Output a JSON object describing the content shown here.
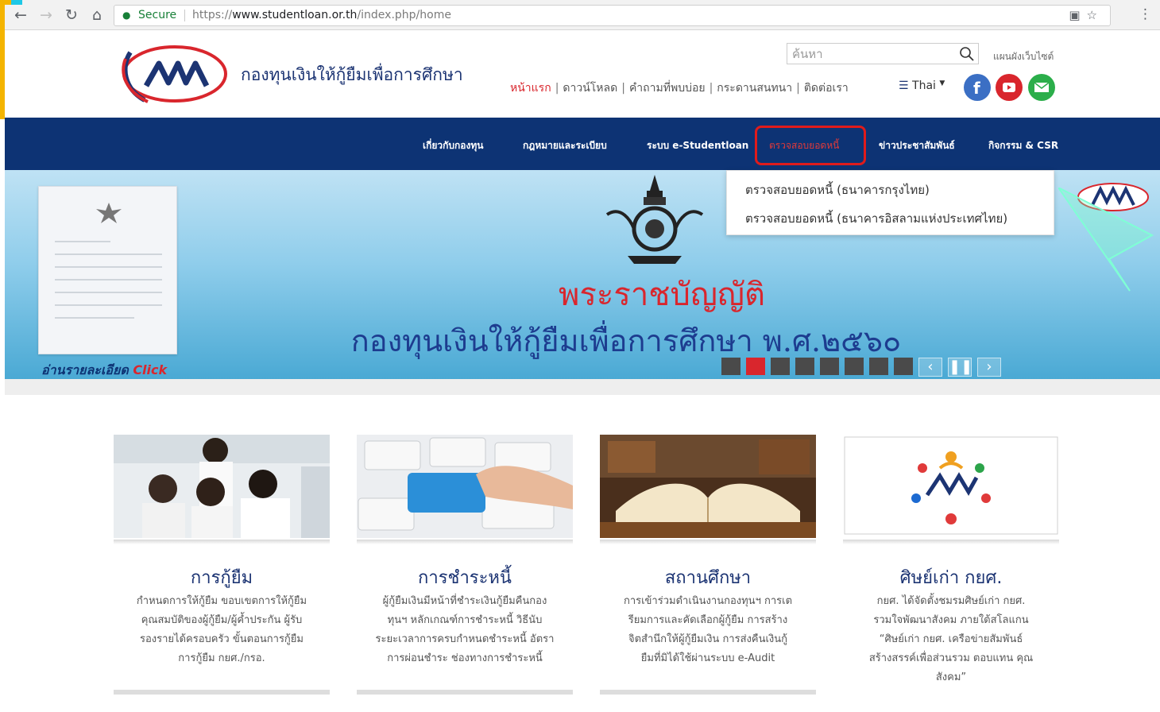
{
  "browser": {
    "back_icon": "arrow-left-icon",
    "secure_label": "Secure",
    "url_scheme": "https://",
    "url_host": "www.studentloan.or.th",
    "url_path": "/index.php/home"
  },
  "header": {
    "org_name": "กองทุนเงินให้กู้ยืมเพื่อการศึกษา",
    "search_placeholder": "ค้นหา",
    "sitemap": "แผนผังเว็บไซต์",
    "top_links": [
      "หน้าแรก",
      "ดาวน์โหลด",
      "คำถามที่พบบ่อย",
      "กระดานสนทนา",
      "ติดต่อเรา"
    ],
    "language": "Thai"
  },
  "nav": {
    "items": [
      "เกี่ยวกับกองทุน",
      "กฎหมายและระเบียบ",
      "ระบบ e-Studentloan",
      "ตรวจสอบยอดหนี้",
      "ข่าวประชาสัมพันธ์",
      "กิจกรรม & CSR"
    ],
    "active_index": 3
  },
  "dropdown": {
    "items": [
      "ตรวจสอบยอดหนี้ (ธนาคารกรุงไทย)",
      "ตรวจสอบยอดหนี้ (ธนาคารอิสลามแห่งประเทศไทย)"
    ]
  },
  "banner": {
    "read_more": "อ่านรายละเอียด",
    "click": "Click",
    "title_line1": "พระราชบัญญัติ",
    "title_line2": "กองทุนเงินให้กู้ยืมเพื่อการศึกษา พ.ศ.๒๕๖๐",
    "slide_count": 8,
    "active_slide": 2
  },
  "cards": [
    {
      "title": "การกู้ยืม",
      "desc_lines": [
        "กำหนดการให้กู้ยืม ขอบเขตการให้กู้ยืม",
        "คุณสมบัติของผู้กู้ยืม/ผู้ค้ำประกัน ผู้รับ",
        "รองรายได้ครอบครัว ขั้นตอนการกู้ยืม",
        "การกู้ยืม กยศ./กรอ."
      ]
    },
    {
      "title": "การชำระหนี้",
      "desc_lines": [
        "ผู้กู้ยืมเงินมีหน้าที่ชำระเงินกู้ยืมคืนกอง",
        "ทุนฯ หลักเกณฑ์การชำระหนี้ วิธีนับ",
        "ระยะเวลาการครบกำหนดชำระหนี้ อัตรา",
        "การผ่อนชำระ ช่องทางการชำระหนี้"
      ]
    },
    {
      "title": "สถานศึกษา",
      "desc_lines": [
        "การเข้าร่วมดำเนินงานกองทุนฯ การเต",
        "รียมการและคัดเลือกผู้กู้ยืม การสร้าง",
        "จิตสำนึกให้ผู้กู้ยืมเงิน การส่งคืนเงินกู้",
        "ยืมที่มิได้ใช้ผ่านระบบ e-Audit"
      ]
    },
    {
      "title": "ศิษย์เก่า กยศ.",
      "desc_lines": [
        "กยศ. ได้จัดตั้งชมรมศิษย์เก่า กยศ.",
        "รวมใจพัฒนาสังคม ภายใต้สโลแกน",
        "“ศิษย์เก่า กยศ. เครือข่ายสัมพันธ์",
        "สร้างสรรค์เพื่อส่วนรวม ตอบแทน คุณ",
        "สังคม”"
      ]
    }
  ],
  "colors": {
    "navy": "#0d3374",
    "red": "#d9262d",
    "title_blue": "#1c3473"
  }
}
